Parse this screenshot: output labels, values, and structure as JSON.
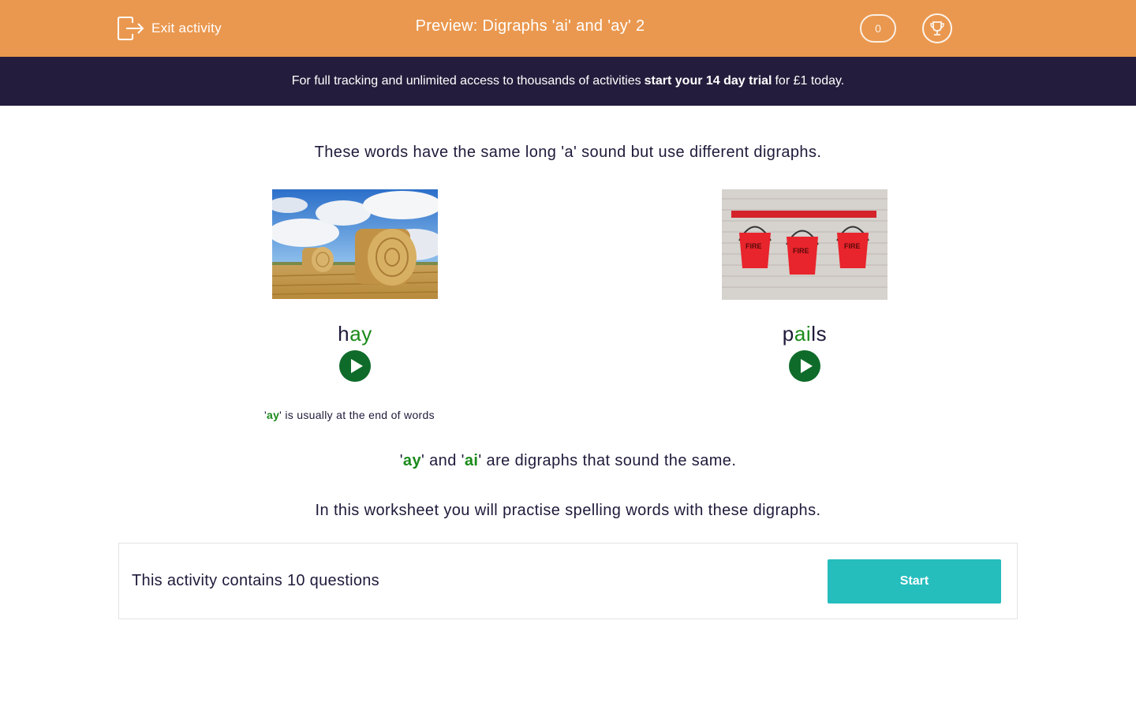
{
  "header": {
    "exit_label": "Exit activity",
    "title": "Preview: Digraphs 'ai' and 'ay' 2",
    "score": "0",
    "accent_color": "#ea984f"
  },
  "banner": {
    "text_before": "For full tracking and unlimited access to thousands of activities",
    "cta": "start your 14 day trial",
    "text_after": "for £1 today.",
    "background": "#241c3c"
  },
  "content": {
    "intro": "These words have the same long 'a' sound but use different digraphs.",
    "cards": [
      {
        "image_icon": "hay-bales-photo",
        "word_start": "h",
        "digraph": "ay",
        "word_end": ""
      },
      {
        "image_icon": "fire-buckets-photo",
        "word_start": "p",
        "digraph": "ai",
        "word_end": "ls"
      }
    ],
    "note": {
      "quote_open": "'",
      "digraph": "ay",
      "rest": "' is usually at the end of words"
    },
    "same": {
      "q1": "'",
      "d1": "ay",
      "mid": "' and '",
      "d2": "ai",
      "rest": "' are digraphs that sound the same."
    },
    "practise": "In this worksheet you will practise spelling words with these digraphs.",
    "digraph_color": "#1a8a1a"
  },
  "footer": {
    "question_count": "This activity contains 10 questions",
    "start_label": "Start",
    "start_color": "#26bdbd"
  }
}
